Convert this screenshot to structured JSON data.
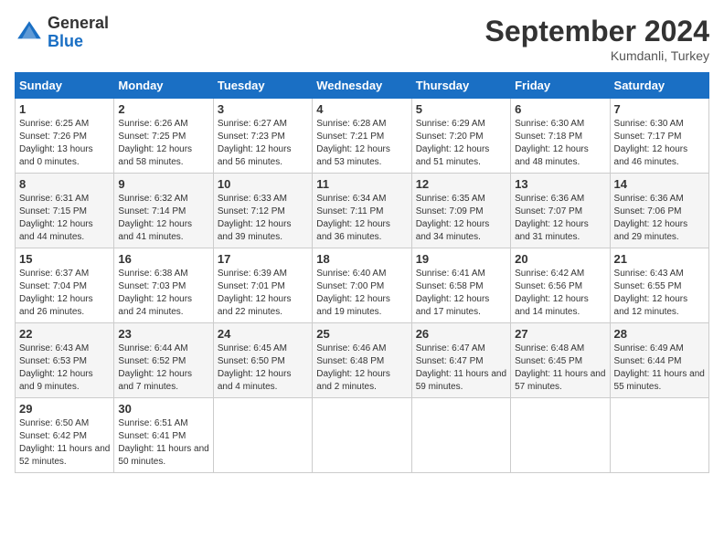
{
  "header": {
    "logo_general": "General",
    "logo_blue": "Blue",
    "month_year": "September 2024",
    "location": "Kumdanli, Turkey"
  },
  "days_of_week": [
    "Sunday",
    "Monday",
    "Tuesday",
    "Wednesday",
    "Thursday",
    "Friday",
    "Saturday"
  ],
  "weeks": [
    [
      {
        "day": "1",
        "sunrise": "Sunrise: 6:25 AM",
        "sunset": "Sunset: 7:26 PM",
        "daylight": "Daylight: 13 hours and 0 minutes."
      },
      {
        "day": "2",
        "sunrise": "Sunrise: 6:26 AM",
        "sunset": "Sunset: 7:25 PM",
        "daylight": "Daylight: 12 hours and 58 minutes."
      },
      {
        "day": "3",
        "sunrise": "Sunrise: 6:27 AM",
        "sunset": "Sunset: 7:23 PM",
        "daylight": "Daylight: 12 hours and 56 minutes."
      },
      {
        "day": "4",
        "sunrise": "Sunrise: 6:28 AM",
        "sunset": "Sunset: 7:21 PM",
        "daylight": "Daylight: 12 hours and 53 minutes."
      },
      {
        "day": "5",
        "sunrise": "Sunrise: 6:29 AM",
        "sunset": "Sunset: 7:20 PM",
        "daylight": "Daylight: 12 hours and 51 minutes."
      },
      {
        "day": "6",
        "sunrise": "Sunrise: 6:30 AM",
        "sunset": "Sunset: 7:18 PM",
        "daylight": "Daylight: 12 hours and 48 minutes."
      },
      {
        "day": "7",
        "sunrise": "Sunrise: 6:30 AM",
        "sunset": "Sunset: 7:17 PM",
        "daylight": "Daylight: 12 hours and 46 minutes."
      }
    ],
    [
      {
        "day": "8",
        "sunrise": "Sunrise: 6:31 AM",
        "sunset": "Sunset: 7:15 PM",
        "daylight": "Daylight: 12 hours and 44 minutes."
      },
      {
        "day": "9",
        "sunrise": "Sunrise: 6:32 AM",
        "sunset": "Sunset: 7:14 PM",
        "daylight": "Daylight: 12 hours and 41 minutes."
      },
      {
        "day": "10",
        "sunrise": "Sunrise: 6:33 AM",
        "sunset": "Sunset: 7:12 PM",
        "daylight": "Daylight: 12 hours and 39 minutes."
      },
      {
        "day": "11",
        "sunrise": "Sunrise: 6:34 AM",
        "sunset": "Sunset: 7:11 PM",
        "daylight": "Daylight: 12 hours and 36 minutes."
      },
      {
        "day": "12",
        "sunrise": "Sunrise: 6:35 AM",
        "sunset": "Sunset: 7:09 PM",
        "daylight": "Daylight: 12 hours and 34 minutes."
      },
      {
        "day": "13",
        "sunrise": "Sunrise: 6:36 AM",
        "sunset": "Sunset: 7:07 PM",
        "daylight": "Daylight: 12 hours and 31 minutes."
      },
      {
        "day": "14",
        "sunrise": "Sunrise: 6:36 AM",
        "sunset": "Sunset: 7:06 PM",
        "daylight": "Daylight: 12 hours and 29 minutes."
      }
    ],
    [
      {
        "day": "15",
        "sunrise": "Sunrise: 6:37 AM",
        "sunset": "Sunset: 7:04 PM",
        "daylight": "Daylight: 12 hours and 26 minutes."
      },
      {
        "day": "16",
        "sunrise": "Sunrise: 6:38 AM",
        "sunset": "Sunset: 7:03 PM",
        "daylight": "Daylight: 12 hours and 24 minutes."
      },
      {
        "day": "17",
        "sunrise": "Sunrise: 6:39 AM",
        "sunset": "Sunset: 7:01 PM",
        "daylight": "Daylight: 12 hours and 22 minutes."
      },
      {
        "day": "18",
        "sunrise": "Sunrise: 6:40 AM",
        "sunset": "Sunset: 7:00 PM",
        "daylight": "Daylight: 12 hours and 19 minutes."
      },
      {
        "day": "19",
        "sunrise": "Sunrise: 6:41 AM",
        "sunset": "Sunset: 6:58 PM",
        "daylight": "Daylight: 12 hours and 17 minutes."
      },
      {
        "day": "20",
        "sunrise": "Sunrise: 6:42 AM",
        "sunset": "Sunset: 6:56 PM",
        "daylight": "Daylight: 12 hours and 14 minutes."
      },
      {
        "day": "21",
        "sunrise": "Sunrise: 6:43 AM",
        "sunset": "Sunset: 6:55 PM",
        "daylight": "Daylight: 12 hours and 12 minutes."
      }
    ],
    [
      {
        "day": "22",
        "sunrise": "Sunrise: 6:43 AM",
        "sunset": "Sunset: 6:53 PM",
        "daylight": "Daylight: 12 hours and 9 minutes."
      },
      {
        "day": "23",
        "sunrise": "Sunrise: 6:44 AM",
        "sunset": "Sunset: 6:52 PM",
        "daylight": "Daylight: 12 hours and 7 minutes."
      },
      {
        "day": "24",
        "sunrise": "Sunrise: 6:45 AM",
        "sunset": "Sunset: 6:50 PM",
        "daylight": "Daylight: 12 hours and 4 minutes."
      },
      {
        "day": "25",
        "sunrise": "Sunrise: 6:46 AM",
        "sunset": "Sunset: 6:48 PM",
        "daylight": "Daylight: 12 hours and 2 minutes."
      },
      {
        "day": "26",
        "sunrise": "Sunrise: 6:47 AM",
        "sunset": "Sunset: 6:47 PM",
        "daylight": "Daylight: 11 hours and 59 minutes."
      },
      {
        "day": "27",
        "sunrise": "Sunrise: 6:48 AM",
        "sunset": "Sunset: 6:45 PM",
        "daylight": "Daylight: 11 hours and 57 minutes."
      },
      {
        "day": "28",
        "sunrise": "Sunrise: 6:49 AM",
        "sunset": "Sunset: 6:44 PM",
        "daylight": "Daylight: 11 hours and 55 minutes."
      }
    ],
    [
      {
        "day": "29",
        "sunrise": "Sunrise: 6:50 AM",
        "sunset": "Sunset: 6:42 PM",
        "daylight": "Daylight: 11 hours and 52 minutes."
      },
      {
        "day": "30",
        "sunrise": "Sunrise: 6:51 AM",
        "sunset": "Sunset: 6:41 PM",
        "daylight": "Daylight: 11 hours and 50 minutes."
      },
      null,
      null,
      null,
      null,
      null
    ]
  ]
}
